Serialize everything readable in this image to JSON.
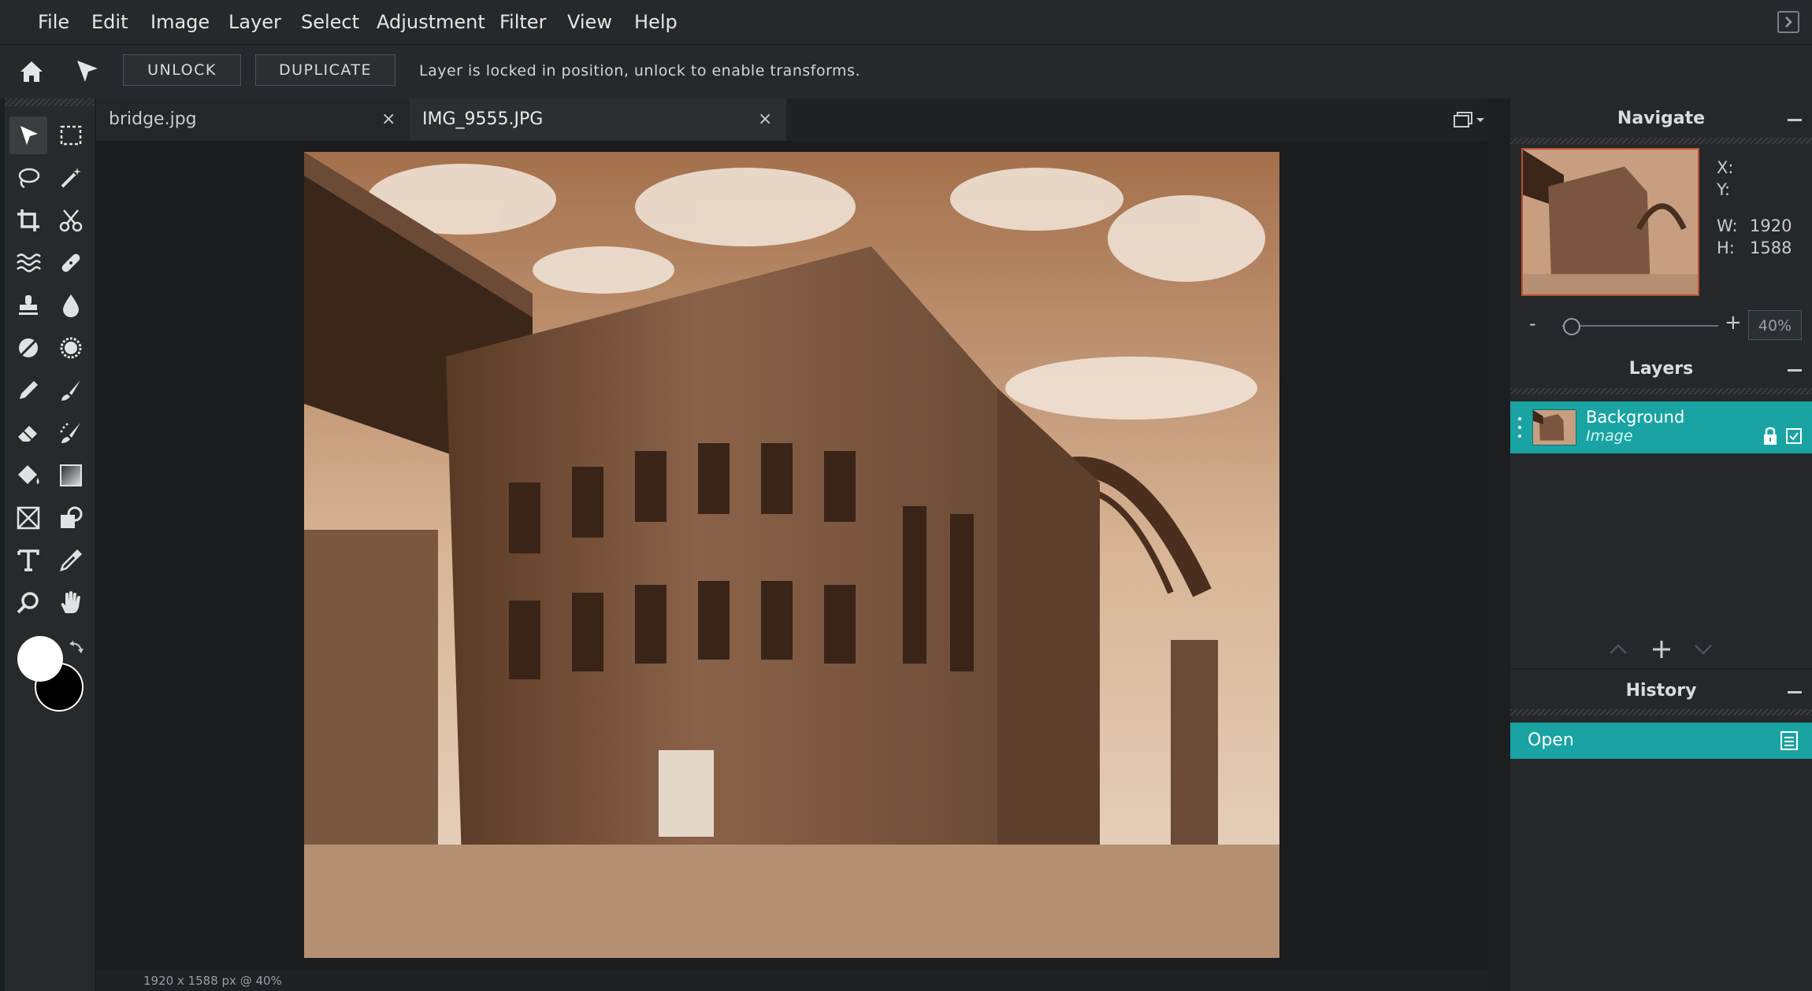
{
  "menu": [
    "File",
    "Edit",
    "Image",
    "Layer",
    "Select",
    "Adjustment",
    "Filter",
    "View",
    "Help"
  ],
  "options": {
    "unlock_label": "UNLOCK",
    "duplicate_label": "DUPLICATE",
    "message": "Layer is locked in position, unlock to enable transforms."
  },
  "tabs": [
    {
      "label": "bridge.jpg",
      "close": "×"
    },
    {
      "label": "IMG_9555.JPG",
      "close": "×"
    }
  ],
  "status": "1920 x 1588 px @ 40%",
  "navigate": {
    "title": "Navigate",
    "x_label": "X:",
    "y_label": "Y:",
    "w_label": "W:",
    "w_value": "1920",
    "h_label": "H:",
    "h_value": "1588",
    "zoom_minus": "-",
    "zoom_plus": "+",
    "zoom_value": "40%",
    "zoom_level": 0.06
  },
  "layers": {
    "title": "Layers",
    "items": [
      {
        "name": "Background",
        "type": "Image"
      }
    ]
  },
  "history": {
    "title": "History",
    "items": [
      {
        "label": "Open"
      }
    ]
  },
  "colors": {
    "accent": "#1aa3a3",
    "foreground": "#ffffff",
    "background": "#000000",
    "thumb_border": "#c0502f"
  }
}
